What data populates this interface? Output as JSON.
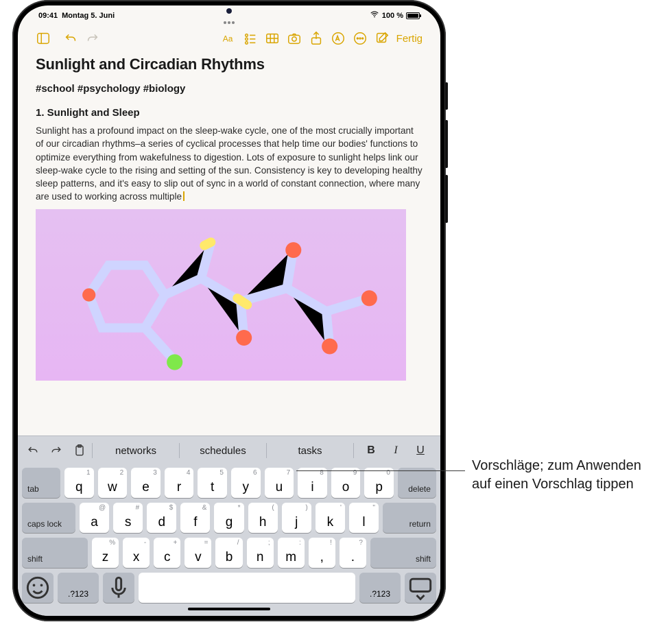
{
  "status": {
    "time": "09:41",
    "date": "Montag 5. Juni",
    "battery_text": "100 %"
  },
  "toolbar": {
    "done_label": "Fertig"
  },
  "note": {
    "title": "Sunlight and Circadian Rhythms",
    "tags": "#school #psychology #biology",
    "subheading": "1. Sunlight and Sleep",
    "paragraph": "Sunlight has a profound impact on the sleep-wake cycle, one of the most crucially important of our circadian rhythms–a series of cyclical processes that help time our bodies' functions to optimize everything from wakefulness to digestion. Lots of exposure to sunlight helps link our sleep-wake cycle to the rising and setting of the sun. Consistency is key to developing healthy sleep patterns, and it's easy to slip out of sync in a world of constant connection, where many are used to working across multiple"
  },
  "suggestions": {
    "s1": "networks",
    "s2": "schedules",
    "s3": "tasks"
  },
  "format": {
    "bold": "B",
    "italic": "I",
    "underline": "U"
  },
  "keys": {
    "row1": [
      "q",
      "w",
      "e",
      "r",
      "t",
      "y",
      "u",
      "i",
      "o",
      "p"
    ],
    "row1_hints": [
      "1",
      "2",
      "3",
      "4",
      "5",
      "6",
      "7",
      "8",
      "9",
      "0"
    ],
    "row2": [
      "a",
      "s",
      "d",
      "f",
      "g",
      "h",
      "j",
      "k",
      "l"
    ],
    "row2_hints": [
      "@",
      "#",
      "$",
      "&",
      "*",
      "(",
      ")",
      "'",
      "\""
    ],
    "row3": [
      "z",
      "x",
      "c",
      "v",
      "b",
      "n",
      "m",
      ",",
      "."
    ],
    "row3_hints": [
      "%",
      "-",
      "+",
      "=",
      "/",
      ";",
      ":",
      "!",
      "?"
    ],
    "tab": "tab",
    "delete": "delete",
    "caps": "caps lock",
    "return": "return",
    "shift": "shift",
    "numswitch": ".?123"
  },
  "callout": "Vorschläge; zum Anwenden auf einen Vorschlag tippen"
}
